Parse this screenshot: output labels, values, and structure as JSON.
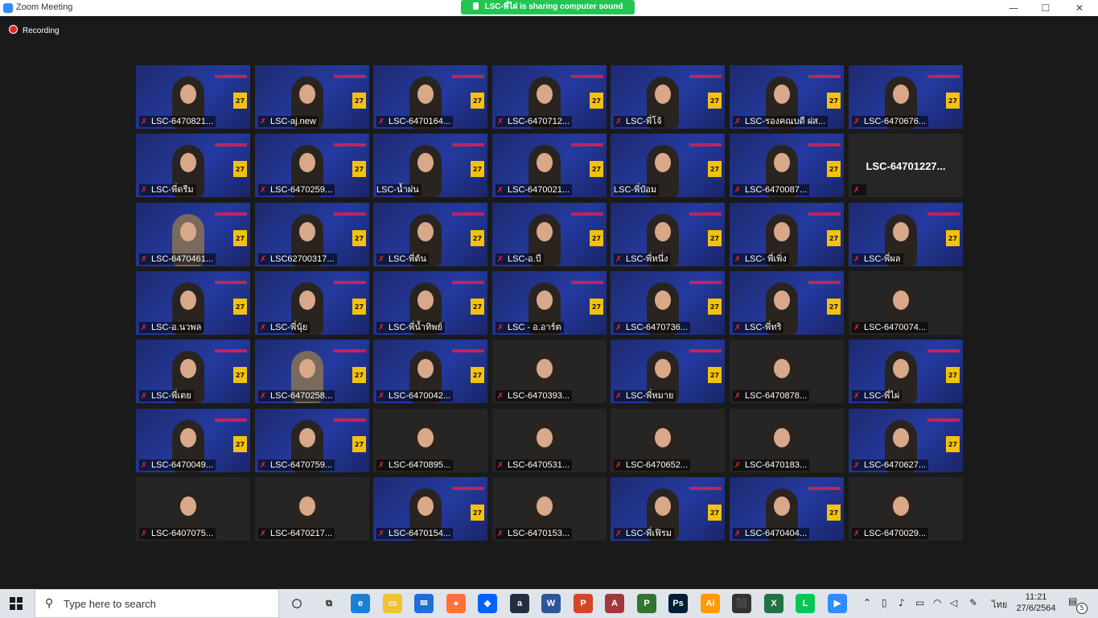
{
  "window": {
    "title": "Zoom Meeting",
    "share_banner": "LSC-พี่ไผ่ is sharing computer sound",
    "minimize_glyph": "—",
    "maximize_glyph": "☐",
    "close_glyph": "✕"
  },
  "recording": {
    "label": "Recording"
  },
  "tiles": [
    {
      "name": "LSC-6470821...",
      "style": "banner",
      "muted": true
    },
    {
      "name": "LSC-aj.new",
      "style": "banner",
      "muted": true
    },
    {
      "name": "LSC-6470164...",
      "style": "banner",
      "muted": true
    },
    {
      "name": "LSC-6470712...",
      "style": "banner",
      "muted": true
    },
    {
      "name": "LSC-พี่โจ้",
      "style": "banner",
      "muted": true
    },
    {
      "name": "LSC-รองคณบดี ฝส...",
      "style": "banner",
      "muted": true
    },
    {
      "name": "LSC-6470676...",
      "style": "banner",
      "muted": true
    },
    {
      "name": "LSC-พี่ดรีม",
      "style": "banner",
      "muted": true
    },
    {
      "name": "LSC-6470259...",
      "style": "banner",
      "muted": true
    },
    {
      "name": "LSC-น้ำฝน",
      "style": "banner",
      "muted": false,
      "active": true
    },
    {
      "name": "LSC-6470021...",
      "style": "banner",
      "muted": true
    },
    {
      "name": "LSC-พี่ป๋อม",
      "style": "banner",
      "muted": false
    },
    {
      "name": "LSC-6470087...",
      "style": "banner",
      "muted": true
    },
    {
      "name": "LSC-64701227...",
      "style": "namecard",
      "muted": true
    },
    {
      "name": "LSC-6470461...",
      "style": "photo",
      "muted": true
    },
    {
      "name": "LSC62700317...",
      "style": "banner",
      "muted": true
    },
    {
      "name": "LSC-พี่ต้น",
      "style": "banner",
      "muted": true
    },
    {
      "name": "LSC-อ.บี",
      "style": "banner",
      "muted": true
    },
    {
      "name": "LSC-พี่หนึ่ง",
      "style": "banner",
      "muted": true
    },
    {
      "name": "LSC- พี่เพิ่ง",
      "style": "banner",
      "muted": true
    },
    {
      "name": "LSC-พี่ผล",
      "style": "banner",
      "muted": true
    },
    {
      "name": "LSC-อ.นวพล",
      "style": "banner",
      "muted": true
    },
    {
      "name": "LSC-พี่นุ้ย",
      "style": "banner",
      "muted": true
    },
    {
      "name": "LSC-พี่น้ำทิพย์",
      "style": "banner",
      "muted": true
    },
    {
      "name": "LSC - อ.อาร์ต",
      "style": "banner",
      "muted": true
    },
    {
      "name": "LSC-6470736...",
      "style": "banner",
      "muted": true
    },
    {
      "name": "LSC-พี่ทริ",
      "style": "banner",
      "muted": true
    },
    {
      "name": "LSC-6470074...",
      "style": "plain",
      "muted": true
    },
    {
      "name": "LSC-พี่เตย",
      "style": "banner",
      "muted": true
    },
    {
      "name": "LSC-6470258...",
      "style": "photo",
      "muted": true
    },
    {
      "name": "LSC-6470042...",
      "style": "banner",
      "muted": true
    },
    {
      "name": "LSC-6470393...",
      "style": "plain",
      "muted": true
    },
    {
      "name": "LSC-พี่หมาย",
      "style": "banner",
      "muted": true
    },
    {
      "name": "LSC-6470878...",
      "style": "plain",
      "muted": true
    },
    {
      "name": "LSC-พี่ไผ่",
      "style": "banner",
      "muted": true
    },
    {
      "name": "LSC-6470049...",
      "style": "banner",
      "muted": true
    },
    {
      "name": "LSC-6470759...",
      "style": "banner",
      "muted": true
    },
    {
      "name": "LSC-6470895...",
      "style": "plain",
      "muted": true
    },
    {
      "name": "LSC-6470531...",
      "style": "plain",
      "muted": true
    },
    {
      "name": "LSC-6470652...",
      "style": "plain",
      "muted": true
    },
    {
      "name": "LSC-6470183...",
      "style": "plain",
      "muted": true
    },
    {
      "name": "LSC-6470627...",
      "style": "banner",
      "muted": true
    },
    {
      "name": "LSC-6407075...",
      "style": "plain",
      "muted": true
    },
    {
      "name": "LSC-6470217...",
      "style": "plain",
      "muted": true
    },
    {
      "name": "LSC-6470154...",
      "style": "banner",
      "muted": true
    },
    {
      "name": "LSC-6470153...",
      "style": "plain",
      "muted": true
    },
    {
      "name": "LSC-พี่เฟิรม",
      "style": "banner",
      "muted": true
    },
    {
      "name": "LSC-6470404...",
      "style": "banner",
      "muted": true
    },
    {
      "name": "LSC-6470029...",
      "style": "plain",
      "muted": true
    }
  ],
  "tile_banner_badge": "27",
  "taskbar": {
    "search_placeholder": "Type here to search",
    "language": "ไทย",
    "time": "11:21",
    "date": "27/6/2564",
    "notification_count": "5",
    "apps": [
      {
        "icon": "task-view-icon",
        "color": "#333333",
        "glyph": "◯"
      },
      {
        "icon": "multitask-icon",
        "color": "#333333",
        "glyph": "⧉"
      },
      {
        "icon": "edge-icon",
        "color": "#1b7fd6",
        "glyph": "e"
      },
      {
        "icon": "file-explorer-icon",
        "color": "#f2c230",
        "glyph": "▭"
      },
      {
        "icon": "mail-icon",
        "color": "#1e6fd8",
        "glyph": "✉"
      },
      {
        "icon": "firefox-icon",
        "color": "#ff7139",
        "glyph": "●"
      },
      {
        "icon": "dropbox-icon",
        "color": "#0061fe",
        "glyph": "◆"
      },
      {
        "icon": "amazon-icon",
        "color": "#232f3e",
        "glyph": "a"
      },
      {
        "icon": "word-icon",
        "color": "#2b579a",
        "glyph": "W"
      },
      {
        "icon": "powerpoint-icon",
        "color": "#d24726",
        "glyph": "P"
      },
      {
        "icon": "access-icon",
        "color": "#a4373a",
        "glyph": "A"
      },
      {
        "icon": "project-icon",
        "color": "#31752f",
        "glyph": "P"
      },
      {
        "icon": "photoshop-icon",
        "color": "#001e36",
        "glyph": "Ps"
      },
      {
        "icon": "illustrator-icon",
        "color": "#ff9a00",
        "glyph": "Ai"
      },
      {
        "icon": "store-icon",
        "color": "#333333",
        "glyph": "⬛"
      },
      {
        "icon": "excel-icon",
        "color": "#217346",
        "glyph": "X"
      },
      {
        "icon": "line-icon",
        "color": "#06c755",
        "glyph": "L"
      },
      {
        "icon": "zoom-icon",
        "color": "#2d8cff",
        "glyph": "▶"
      }
    ]
  }
}
